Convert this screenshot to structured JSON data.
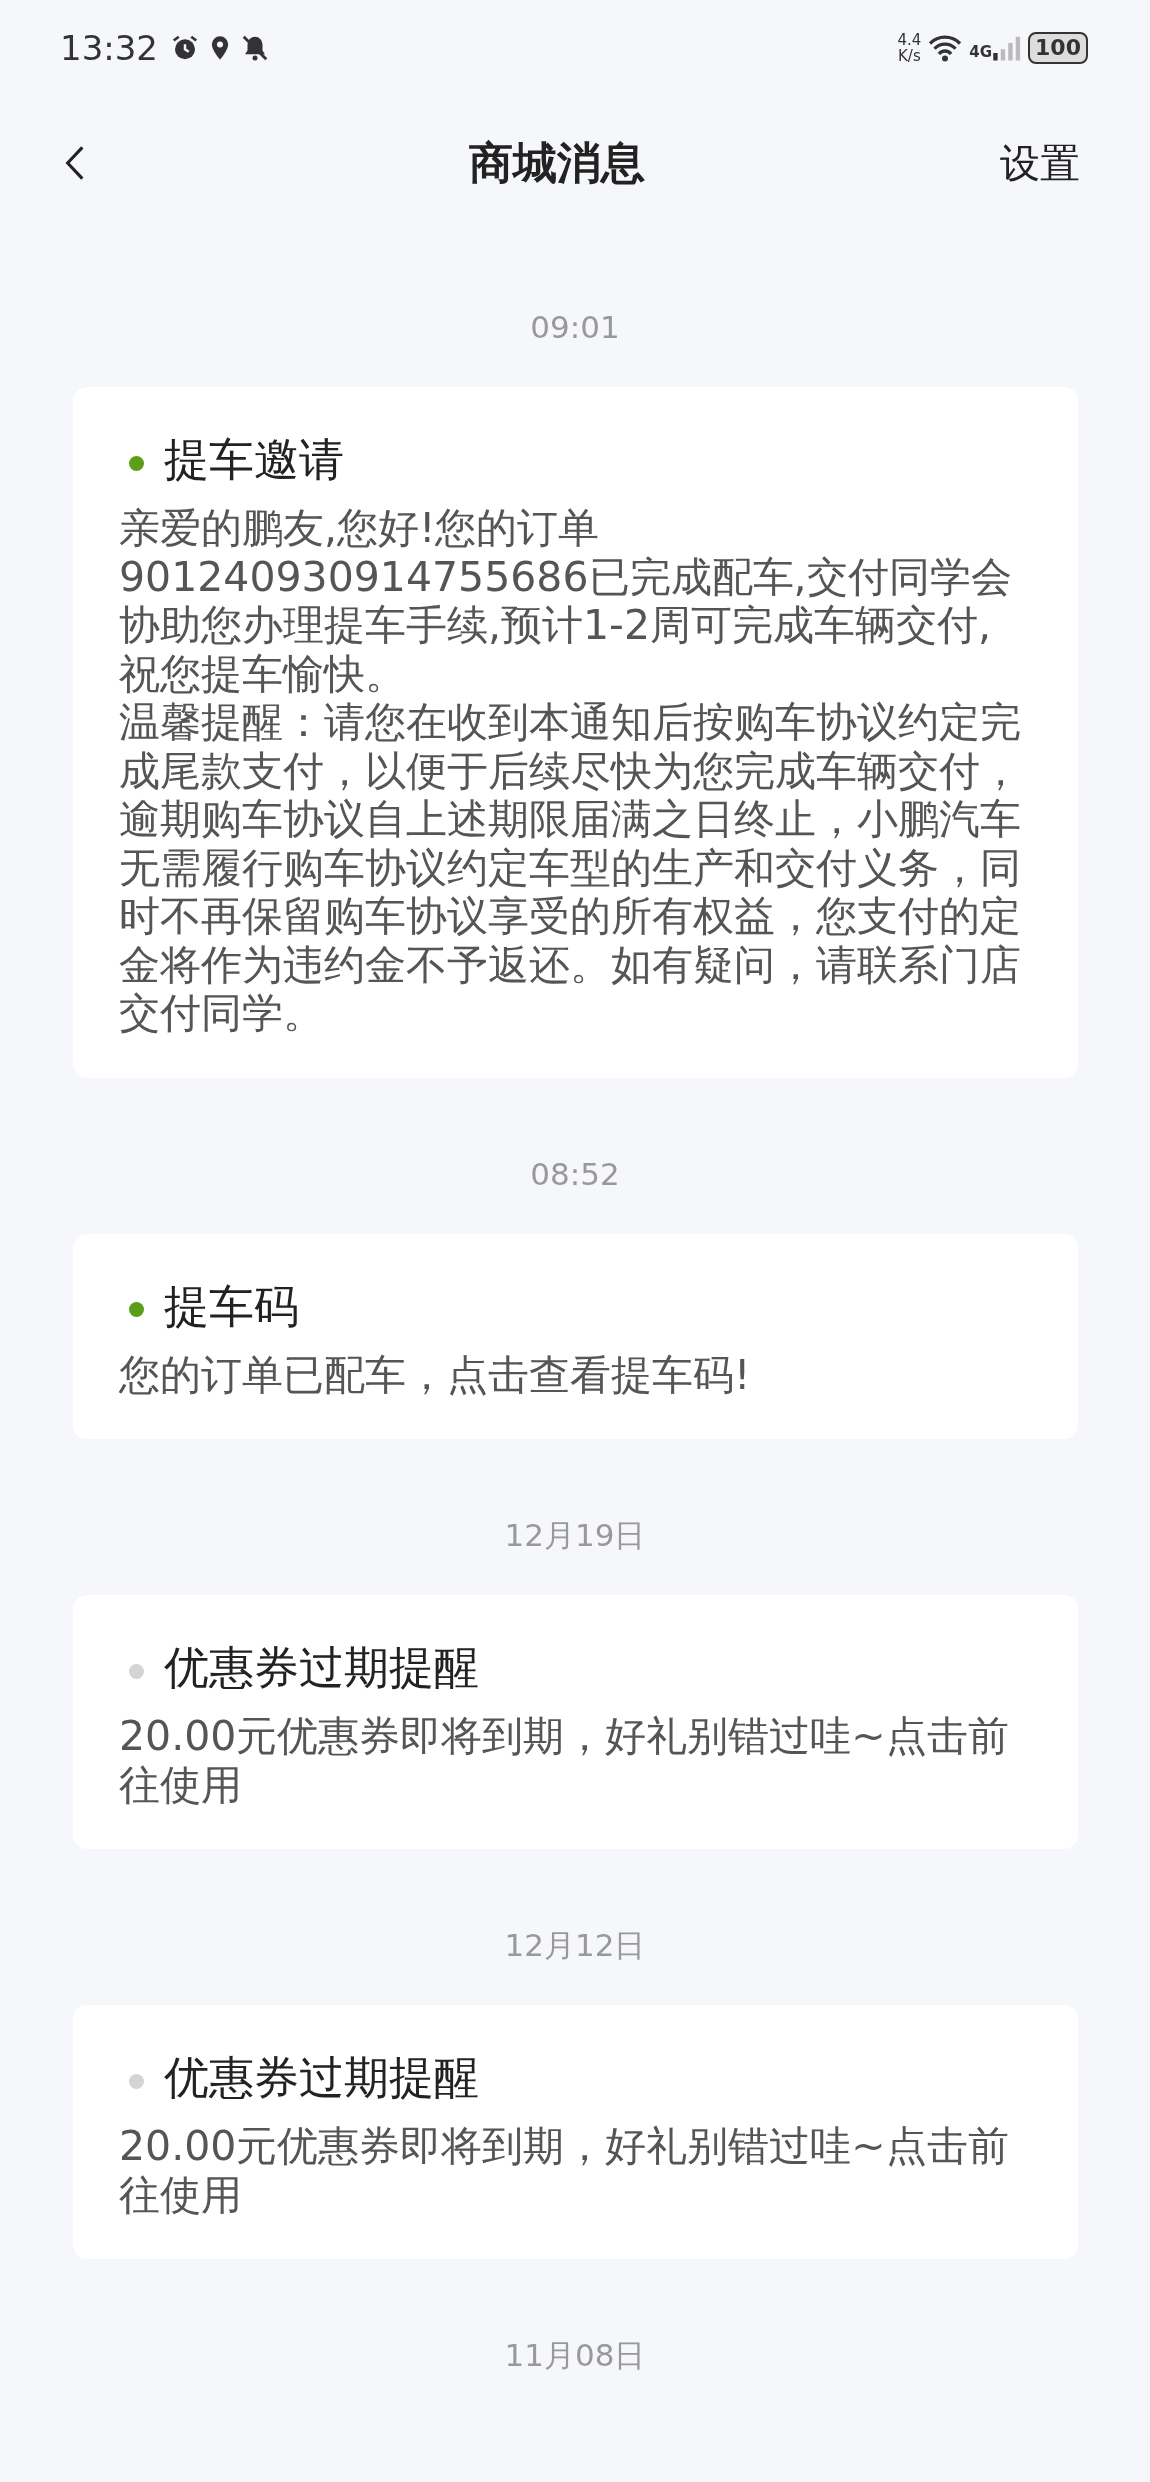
{
  "status_bar": {
    "time": "13:32",
    "speed_value": "4.4",
    "speed_unit": "K/s",
    "network": "4G",
    "battery": "100"
  },
  "header": {
    "title": "商城消息",
    "action": "设置"
  },
  "sections": [
    {
      "time": "09:01",
      "message": {
        "title": "提车邀请",
        "unread": true,
        "paragraphs": [
          "亲爱的鹏友,您好!您的订单901240930914755686已完成配车,交付同学会协助您办理提车手续,预计1-2周可完成车辆交付,祝您提车愉快。",
          "温馨提醒：请您在收到本通知后按购车协议约定完成尾款支付，以便于后续尽快为您完成车辆交付，逾期购车协议自上述期限届满之日终止，小鹏汽车无需履行购车协议约定车型的生产和交付义务，同时不再保留购车协议享受的所有权益，您支付的定金将作为违约金不予返还。如有疑问，请联系门店交付同学。"
        ]
      }
    },
    {
      "time": "08:52",
      "message": {
        "title": "提车码",
        "unread": true,
        "paragraphs": [
          "您的订单已配车，点击查看提车码!"
        ]
      }
    },
    {
      "time": "12月19日",
      "message": {
        "title": "优惠券过期提醒",
        "unread": false,
        "paragraphs": [
          "20.00元优惠券即将到期，好礼别错过哇~点击前往使用"
        ]
      }
    },
    {
      "time": "12月12日",
      "message": {
        "title": "优惠券过期提醒",
        "unread": false,
        "paragraphs": [
          "20.00元优惠券即将到期，好礼别错过哇~点击前往使用"
        ]
      }
    },
    {
      "time": "11月08日"
    }
  ]
}
